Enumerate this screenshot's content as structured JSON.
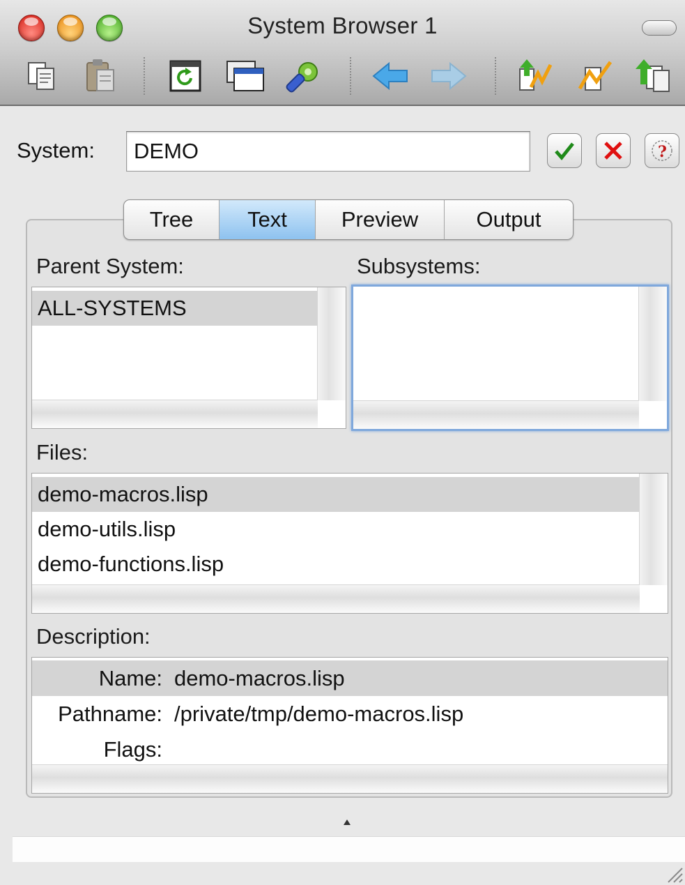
{
  "window": {
    "title": "System Browser 1"
  },
  "toolbar": {
    "buttons": [
      {
        "name": "copy-icon"
      },
      {
        "name": "paste-icon"
      },
      {
        "name": "refresh-icon"
      },
      {
        "name": "new-window-icon"
      },
      {
        "name": "preferences-icon"
      },
      {
        "name": "back-arrow-icon"
      },
      {
        "name": "forward-arrow-icon"
      },
      {
        "name": "compile-load-icon"
      },
      {
        "name": "compile-icon"
      },
      {
        "name": "load-icon"
      }
    ]
  },
  "system_field": {
    "label": "System:",
    "value": "DEMO",
    "confirm_icon": "checkmark-icon",
    "cancel_icon": "cross-icon",
    "help_icon": "question-icon"
  },
  "tabs": [
    {
      "label": "Tree",
      "active": false
    },
    {
      "label": "Text",
      "active": true
    },
    {
      "label": "Preview",
      "active": false
    },
    {
      "label": "Output",
      "active": false
    }
  ],
  "parent_system": {
    "label": "Parent System:",
    "items": [
      "ALL-SYSTEMS"
    ]
  },
  "subsystems": {
    "label": "Subsystems:",
    "items": []
  },
  "files": {
    "label": "Files:",
    "items": [
      "demo-macros.lisp",
      "demo-utils.lisp",
      "demo-functions.lisp"
    ],
    "selected": "demo-macros.lisp"
  },
  "description": {
    "label": "Description:",
    "rows": [
      {
        "key": "Name:",
        "value": "demo-macros.lisp"
      },
      {
        "key": "Pathname:",
        "value": "/private/tmp/demo-macros.lisp"
      },
      {
        "key": "Flags:",
        "value": ""
      }
    ]
  },
  "colors": {
    "active_tab": "#8ec2ef",
    "focus_ring": "#7fa8dc",
    "selection": "#d4d4d4"
  }
}
